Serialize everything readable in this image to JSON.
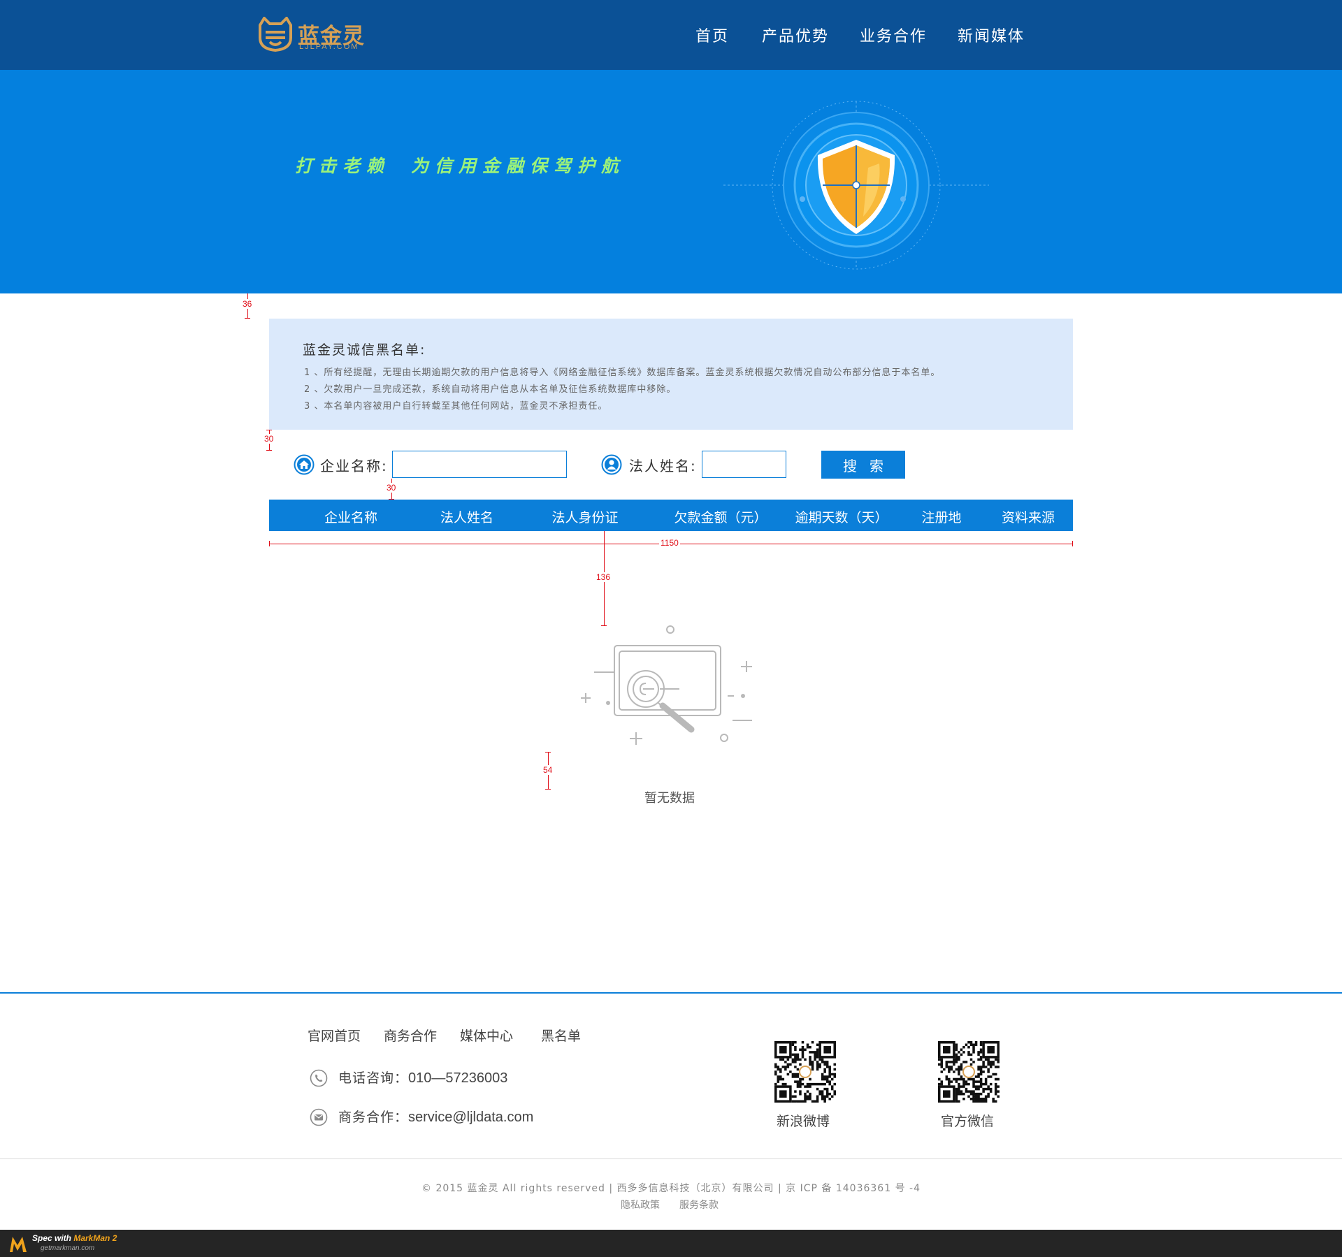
{
  "header": {
    "logo_text": "蓝金灵",
    "logo_sub": "LJLPAY.COM",
    "nav": [
      "首页",
      "产品优势",
      "业务合作",
      "新闻媒体"
    ]
  },
  "banner": {
    "slogan_1": "打击老赖",
    "slogan_2": "为信用金融保驾护航"
  },
  "notice": {
    "title": "蓝金灵诚信黑名单:",
    "lines": [
      "1 、所有经提醒，无理由长期逾期欠款的用户信息将导入《网络金融征信系统》数据库备案。蓝金灵系统根据欠款情况自动公布部分信息于本名单。",
      "2 、欠款用户一旦完成还款，系统自动将用户信息从本名单及征信系统数据库中移除。",
      "3 、本名单内容被用户自行转载至其他任何网站，蓝金灵不承担责任。"
    ]
  },
  "search": {
    "company_label": "企业名称:",
    "company_value": "",
    "person_label": "法人姓名:",
    "person_value": "",
    "button": "搜索"
  },
  "table": {
    "headers": [
      "企业名称",
      "法人姓名",
      "法人身份证",
      "欠款金额（元）",
      "逾期天数（天）",
      "注册地",
      "资料来源"
    ]
  },
  "empty": {
    "text": "暂无数据"
  },
  "specs": {
    "s36": "36",
    "s30a": "30",
    "s30b": "30",
    "s1150": "1150",
    "s136": "136",
    "s54": "54"
  },
  "footer": {
    "links": [
      "官网首页",
      "商务合作",
      "媒体中心",
      "黑名单"
    ],
    "phone_label": "电话咨询：",
    "phone_value": "010—57236003",
    "email_label": "商务合作：",
    "email_value": "service@ljldata.com",
    "qr_1": "新浪微博",
    "qr_2": "官方微信",
    "copyright": "© 2015 蓝金灵 All rights reserved | 西多多信息科技（北京）有限公司 | 京 ICP 备 14036361 号 -4",
    "privacy": "隐私政策",
    "terms": "服务条款"
  },
  "markman": {
    "line1_a": "Spec with ",
    "line1_b": "MarkMan 2",
    "line2": "getmarkman.com"
  },
  "colors": {
    "topbar": "#0b5196",
    "banner": "#0480de",
    "accent": "#0b7fd9",
    "slogan": "#9cf27a",
    "notice_bg": "#dbe9fb",
    "logo": "#d7a155"
  }
}
